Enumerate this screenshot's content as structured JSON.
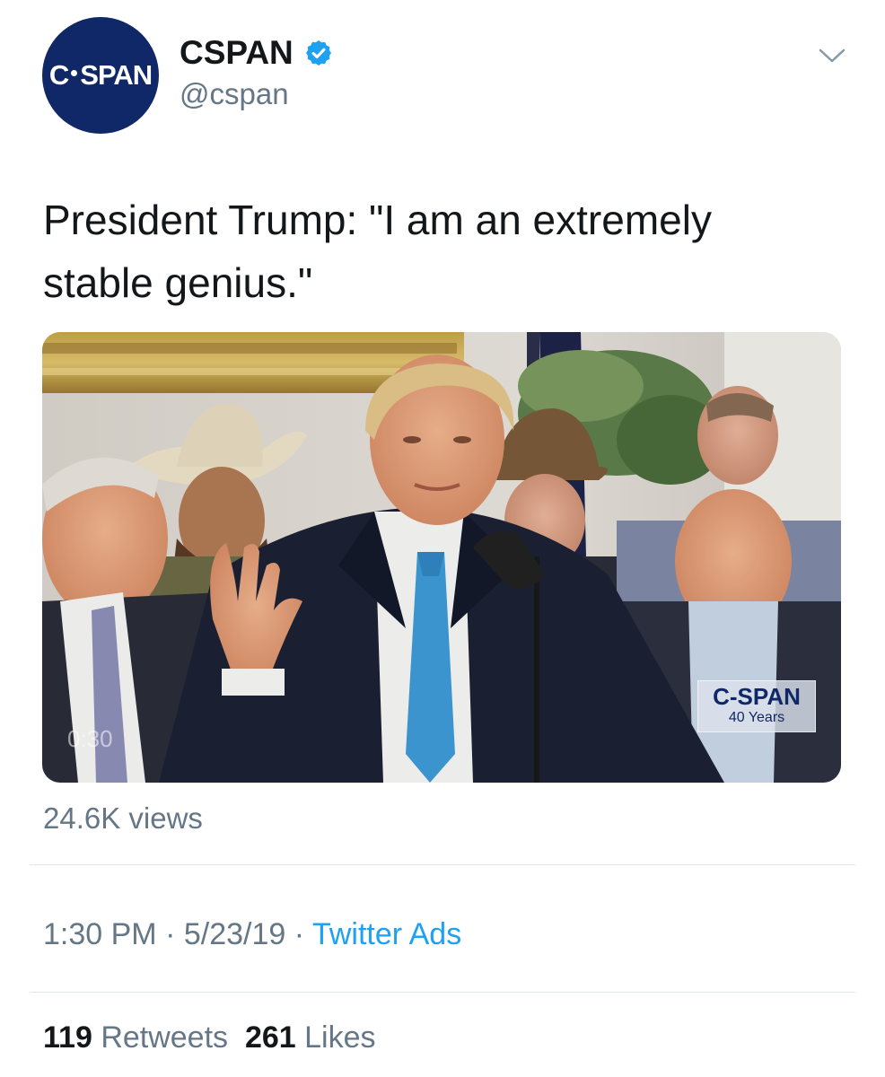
{
  "author": {
    "avatar_text_left": "C",
    "avatar_text_right": "SPAN",
    "display_name": "CSPAN",
    "handle": "@cspan",
    "avatar_color": "#102768",
    "verified_color": "#1da1f2"
  },
  "tweet": {
    "text": "President Trump: \"I am an extremely stable genius.\"",
    "video": {
      "duration": "0:30",
      "watermark_main": "C-SPAN",
      "watermark_sub": "40 Years"
    },
    "views": "24.6K views",
    "time": "1:30 PM",
    "date": "5/23/19",
    "source": "Twitter Ads",
    "separator": "·",
    "retweets_count": "119",
    "retweets_label": "Retweets",
    "likes_count": "261",
    "likes_label": "Likes"
  },
  "colors": {
    "text_primary": "#14171a",
    "text_secondary": "#657786",
    "link": "#1da1f2",
    "divider": "#e1e8ed"
  },
  "icons": {
    "verified": "verified-badge-icon",
    "menu": "chevron-down-icon"
  }
}
